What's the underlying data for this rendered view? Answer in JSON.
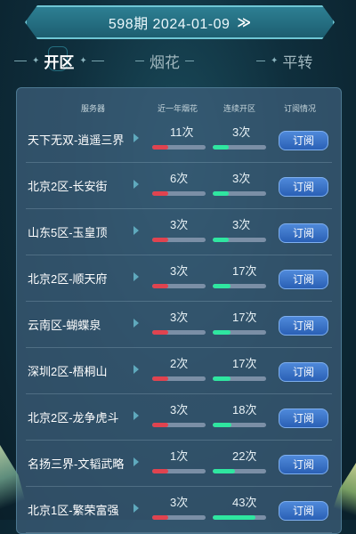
{
  "issue": {
    "label": "598期 2024-01-09",
    "arrow": "≫"
  },
  "tabs": [
    {
      "label": "开区",
      "active": true
    },
    {
      "label": "烟花",
      "active": false
    },
    {
      "label": "平转",
      "active": false
    }
  ],
  "table": {
    "headers": [
      "服务器",
      "近一年烟花",
      "连续开区",
      "订阅情况"
    ],
    "subscribe_label": "订阅",
    "rows": [
      {
        "server": "天下无双-逍遥三界",
        "fireworks": "11次",
        "fireworks_level": 0.3,
        "consecutive": "3次",
        "consecutive_level": 0.3
      },
      {
        "server": "北京2区-长安街",
        "fireworks": "6次",
        "fireworks_level": 0.3,
        "consecutive": "3次",
        "consecutive_level": 0.3
      },
      {
        "server": "山东5区-玉皇顶",
        "fireworks": "3次",
        "fireworks_level": 0.3,
        "consecutive": "3次",
        "consecutive_level": 0.3
      },
      {
        "server": "北京2区-顺天府",
        "fireworks": "3次",
        "fireworks_level": 0.3,
        "consecutive": "17次",
        "consecutive_level": 0.33
      },
      {
        "server": "云南区-蝴蝶泉",
        "fireworks": "3次",
        "fireworks_level": 0.3,
        "consecutive": "17次",
        "consecutive_level": 0.33
      },
      {
        "server": "深圳2区-梧桐山",
        "fireworks": "2次",
        "fireworks_level": 0.3,
        "consecutive": "17次",
        "consecutive_level": 0.33
      },
      {
        "server": "北京2区-龙争虎斗",
        "fireworks": "3次",
        "fireworks_level": 0.3,
        "consecutive": "18次",
        "consecutive_level": 0.35
      },
      {
        "server": "名扬三界-文韬武略",
        "fireworks": "1次",
        "fireworks_level": 0.3,
        "consecutive": "22次",
        "consecutive_level": 0.42
      },
      {
        "server": "北京1区-繁荣富强",
        "fireworks": "3次",
        "fireworks_level": 0.3,
        "consecutive": "43次",
        "consecutive_level": 0.8
      }
    ]
  }
}
